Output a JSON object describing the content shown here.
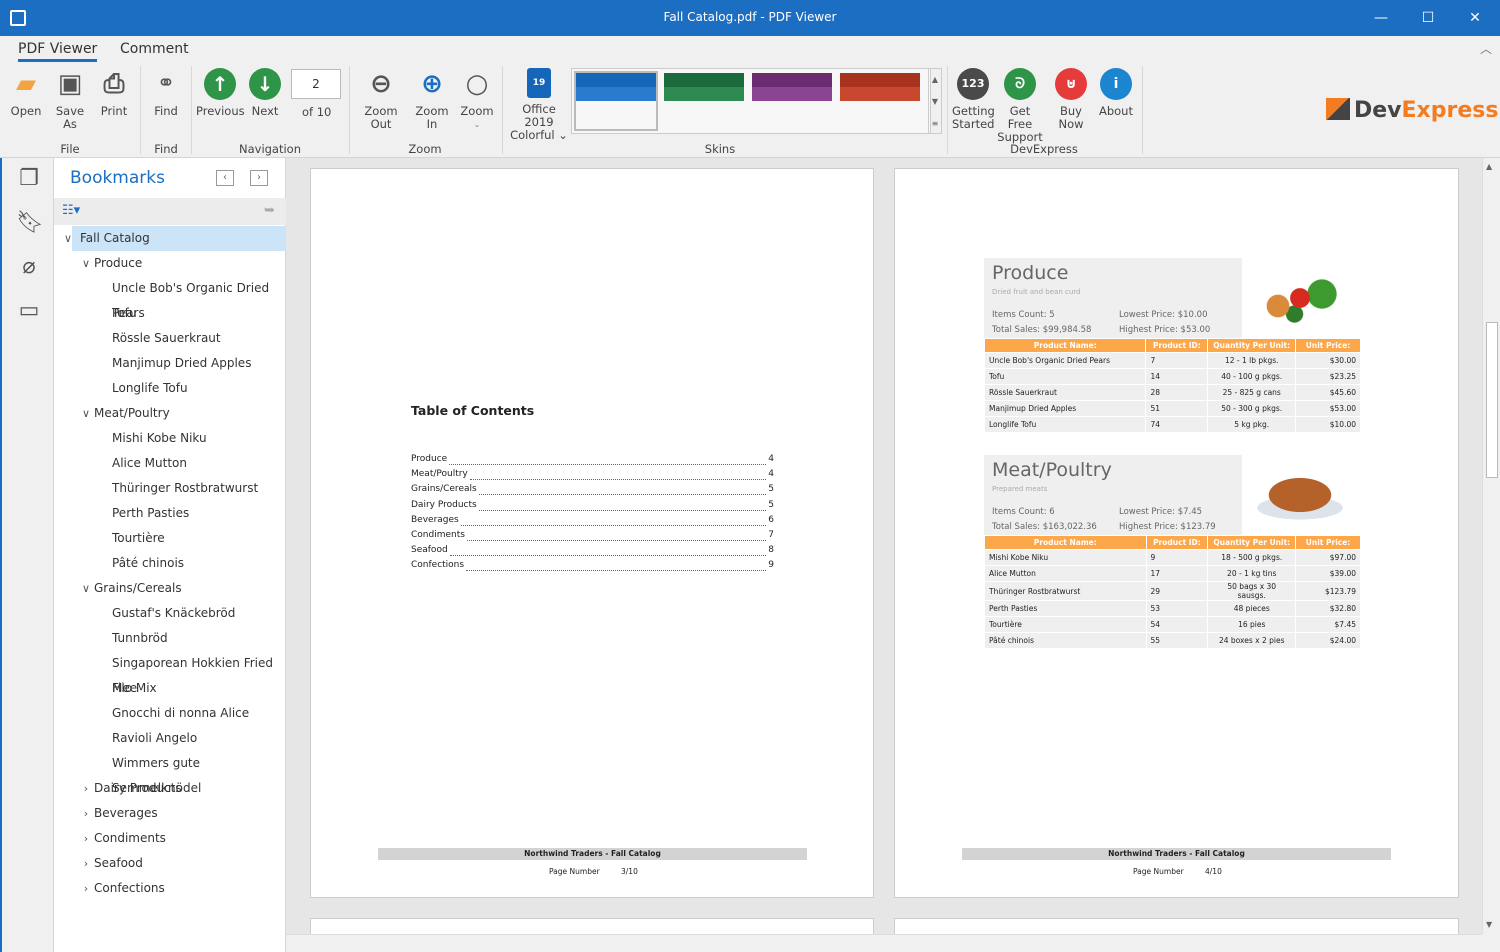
{
  "window": {
    "title": "Fall Catalog.pdf - PDF Viewer",
    "minimize": "—",
    "maximize": "☐",
    "close": "✕"
  },
  "tabs": [
    "PDF Viewer",
    "Comment"
  ],
  "ribbon": {
    "file": {
      "open": "Open",
      "save_as": "Save As",
      "print": "Print",
      "group": "File"
    },
    "find": {
      "find": "Find",
      "group": "Find"
    },
    "navigation": {
      "previous": "Previous",
      "next": "Next",
      "page": "2",
      "of": "of 10",
      "group": "Navigation"
    },
    "zoom": {
      "zoom_out": "Zoom Out",
      "zoom_in": "Zoom In",
      "zoom": "Zoom",
      "group": "Zoom"
    },
    "skins": {
      "current_line1": "Office 2019",
      "current_line2": "Colorful",
      "group": "Skins",
      "swatches": [
        [
          "#1565b8",
          "#2a7bd0"
        ],
        [
          "#1d6b3c",
          "#2f8a52"
        ],
        [
          "#6b2b73",
          "#8a4492"
        ],
        [
          "#a8321e",
          "#c9472f"
        ]
      ]
    },
    "devexpress": {
      "getting_started": [
        "Getting",
        "Started"
      ],
      "support": [
        "Get Free",
        "Support"
      ],
      "buy": "Buy Now",
      "about": "About",
      "group": "DevExpress",
      "logo_dev": "Dev",
      "logo_express": "Express"
    }
  },
  "bookmarks": {
    "title": "Bookmarks",
    "items": [
      {
        "label": "Fall Catalog",
        "level": 0,
        "state": "open",
        "selected": true
      },
      {
        "label": "Produce",
        "level": 1,
        "state": "open"
      },
      {
        "label": "Uncle Bob's Organic Dried Pears",
        "level": 2
      },
      {
        "label": "Tofu",
        "level": 2
      },
      {
        "label": "Rössle Sauerkraut",
        "level": 2
      },
      {
        "label": "Manjimup Dried Apples",
        "level": 2
      },
      {
        "label": "Longlife Tofu",
        "level": 2
      },
      {
        "label": "Meat/Poultry",
        "level": 1,
        "state": "open"
      },
      {
        "label": "Mishi Kobe Niku",
        "level": 2
      },
      {
        "label": "Alice Mutton",
        "level": 2
      },
      {
        "label": "Thüringer Rostbratwurst",
        "level": 2
      },
      {
        "label": "Perth Pasties",
        "level": 2
      },
      {
        "label": "Tourtière",
        "level": 2
      },
      {
        "label": "Pâté chinois",
        "level": 2
      },
      {
        "label": "Grains/Cereals",
        "level": 1,
        "state": "open"
      },
      {
        "label": "Gustaf's Knäckebröd",
        "level": 2
      },
      {
        "label": "Tunnbröd",
        "level": 2
      },
      {
        "label": "Singaporean Hokkien Fried Mee",
        "level": 2
      },
      {
        "label": "Filo Mix",
        "level": 2
      },
      {
        "label": "Gnocchi di nonna Alice",
        "level": 2
      },
      {
        "label": "Ravioli Angelo",
        "level": 2
      },
      {
        "label": "Wimmers gute Semmelknödel",
        "level": 2
      },
      {
        "label": "Dairy Products",
        "level": 1,
        "state": "closed"
      },
      {
        "label": "Beverages",
        "level": 1,
        "state": "closed"
      },
      {
        "label": "Condiments",
        "level": 1,
        "state": "closed"
      },
      {
        "label": "Seafood",
        "level": 1,
        "state": "closed"
      },
      {
        "label": "Confections",
        "level": 1,
        "state": "closed"
      }
    ]
  },
  "page3": {
    "toc_title": "Table of Contents",
    "toc": [
      [
        "Produce",
        "4"
      ],
      [
        "Meat/Poultry",
        "4"
      ],
      [
        "Grains/Cereals",
        "5"
      ],
      [
        "Dairy Products",
        "5"
      ],
      [
        "Beverages",
        "6"
      ],
      [
        "Condiments",
        "7"
      ],
      [
        "Seafood",
        "8"
      ],
      [
        "Confections",
        "9"
      ]
    ],
    "footer": "Northwind Traders  - Fall Catalog",
    "page_label": "Page Number",
    "page_value": "3/10"
  },
  "page4": {
    "columns": [
      "Product Name:",
      "Product ID:",
      "Quantity Per Unit:",
      "Unit Price:"
    ],
    "categories": [
      {
        "name": "Produce",
        "desc": "Dried fruit and bean curd",
        "items_count": "Items Count: 5",
        "total_sales": "Total Sales: $99,984.58",
        "lowest": "Lowest Price: $10.00",
        "highest": "Highest Price: $53.00",
        "rows": [
          [
            "Uncle Bob's Organic Dried Pears",
            "7",
            "12 - 1 lb pkgs.",
            "$30.00"
          ],
          [
            "Tofu",
            "14",
            "40 - 100 g pkgs.",
            "$23.25"
          ],
          [
            "Rössle Sauerkraut",
            "28",
            "25 - 825 g cans",
            "$45.60"
          ],
          [
            "Manjimup Dried Apples",
            "51",
            "50 - 300 g pkgs.",
            "$53.00"
          ],
          [
            "Longlife Tofu",
            "74",
            "5 kg pkg.",
            "$10.00"
          ]
        ]
      },
      {
        "name": "Meat/Poultry",
        "desc": "Prepared meats",
        "items_count": "Items Count: 6",
        "total_sales": "Total Sales: $163,022.36",
        "lowest": "Lowest Price: $7.45",
        "highest": "Highest Price: $123.79",
        "rows": [
          [
            "Mishi Kobe Niku",
            "9",
            "18 - 500 g pkgs.",
            "$97.00"
          ],
          [
            "Alice Mutton",
            "17",
            "20 - 1 kg tins",
            "$39.00"
          ],
          [
            "Thüringer Rostbratwurst",
            "29",
            "50 bags x 30 sausgs.",
            "$123.79"
          ],
          [
            "Perth Pasties",
            "53",
            "48 pieces",
            "$32.80"
          ],
          [
            "Tourtière",
            "54",
            "16 pies",
            "$7.45"
          ],
          [
            "Pâté chinois",
            "55",
            "24 boxes x 2 pies",
            "$24.00"
          ]
        ]
      }
    ],
    "footer": "Northwind Traders  - Fall Catalog",
    "page_label": "Page Number",
    "page_value": "4/10"
  }
}
